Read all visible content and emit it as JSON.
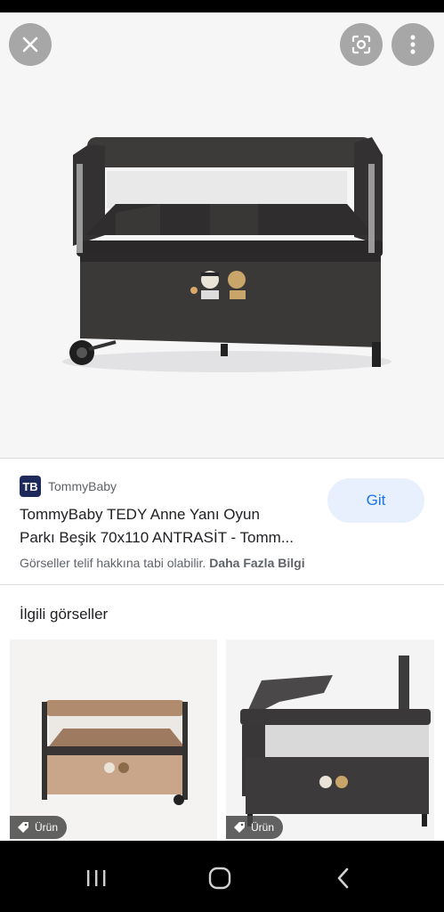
{
  "source": {
    "favicon_text": "TB",
    "name": "TommyBaby"
  },
  "result": {
    "title_line1": "TommyBaby TEDY Anne Yanı Oyun",
    "title_line2": "Parkı Beşik 70x110 ANTRASİT - Tomm...",
    "go_label": "Git",
    "copyright_text": "Görseller telif hakkına tabi olabilir. ",
    "more_info": "Daha Fazla Bilgi"
  },
  "related": {
    "heading": "İlgili görseller",
    "items": [
      {
        "badge": "Ürün"
      },
      {
        "badge": "Ürün"
      }
    ]
  },
  "colors": {
    "accent": "#1a73e8",
    "chip_bg": "#e8f0fe",
    "crib": "#3b3838",
    "crib_tan": "#c9a58a"
  },
  "icons": {
    "close": "close-icon",
    "lens": "google-lens-icon",
    "more": "more-vert-icon",
    "tag": "tag-icon"
  }
}
